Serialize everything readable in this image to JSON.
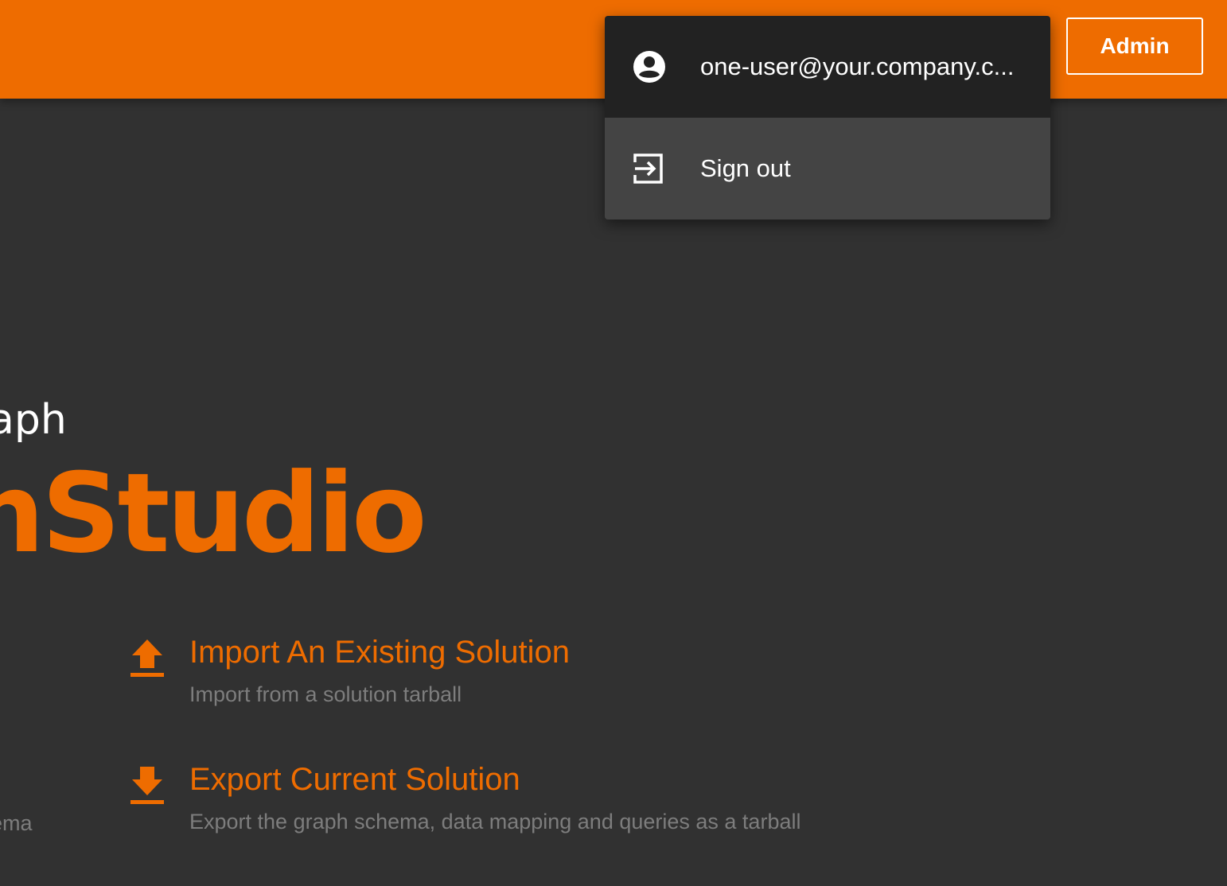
{
  "header": {
    "admin_label": "Admin",
    "accent_color": "#ee6c00"
  },
  "user_menu": {
    "email": "one-user@your.company.c...",
    "user_icon": "account-circle-icon",
    "signout_label": "Sign out",
    "signout_icon": "sign-out-icon"
  },
  "logo": {
    "top_text": "aph",
    "main_text": "hStudio"
  },
  "actions": [
    {
      "title": "Import An Existing Solution",
      "description": "Import from a solution tarball",
      "icon": "upload-icon"
    },
    {
      "title": "Export Current Solution",
      "description": "Export the graph schema, data mapping and queries as a tarball",
      "icon": "download-icon"
    }
  ],
  "left_fragment": "ema",
  "colors": {
    "background": "#313131",
    "menu_top": "#222222",
    "menu_bottom": "#444444",
    "muted_text": "#7d7d7d"
  }
}
